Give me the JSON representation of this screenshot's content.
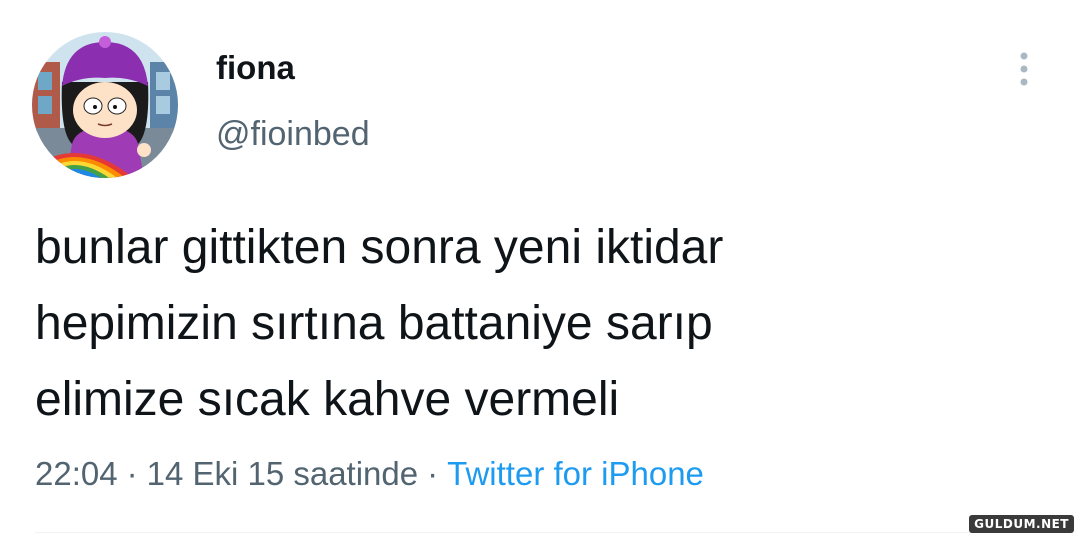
{
  "user": {
    "display_name": "fiona",
    "handle": "@fioinbed"
  },
  "tweet": {
    "lines": [
      "bunlar gittikten sonra yeni iktidar",
      "hepimizin sırtına battaniye sarıp",
      "elimize sıcak kahve vermeli"
    ]
  },
  "meta": {
    "time": "22:04",
    "separator": "·",
    "date": "14 Eki 15 saatinde",
    "source": "Twitter for iPhone"
  },
  "icons": {
    "more": "more-dots-vertical-icon",
    "avatar": "avatar-cartoon-girl-purple-hat"
  },
  "colors": {
    "text_primary": "#0f1419",
    "text_secondary": "#536471",
    "link": "#1d9bf0",
    "more_icon": "#aab8c2"
  },
  "watermark": "GULDUM.NET"
}
